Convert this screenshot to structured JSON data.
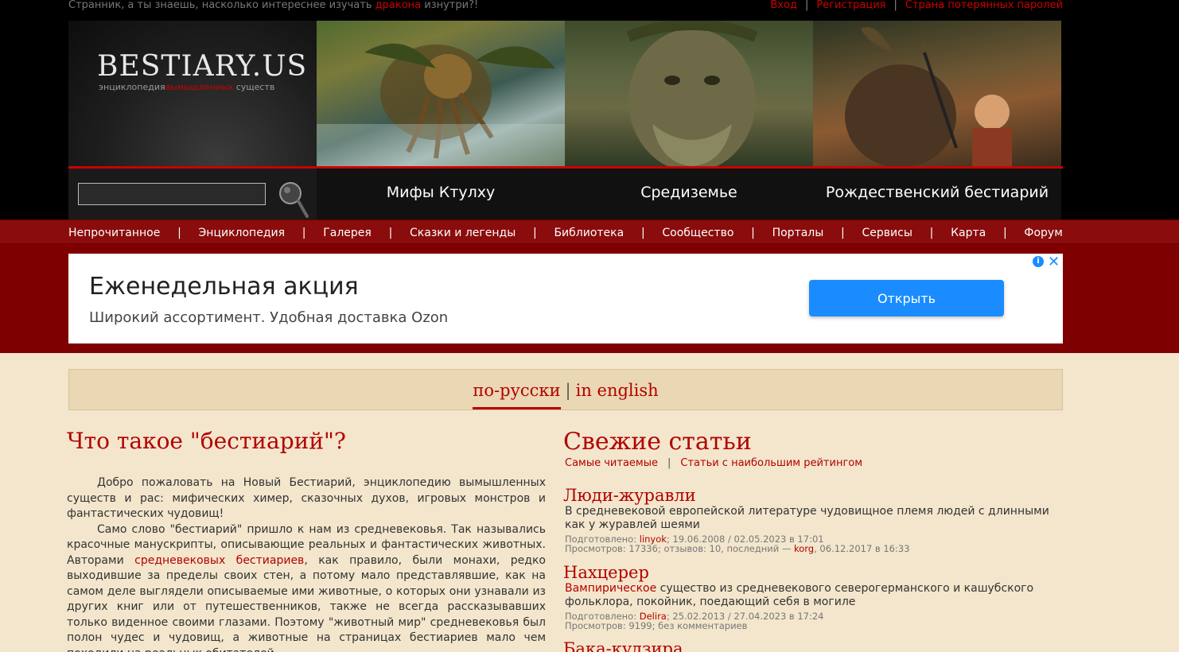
{
  "topbar": {
    "tagline_start": "Странник, а ты знаешь, насколько интереснее изучать ",
    "tagline_link": "дракона",
    "tagline_end": " изнутри?!",
    "login": "Вход",
    "register": "Регистрация",
    "lost_password": "Страна потерянных паролей",
    "separator": "|"
  },
  "logo": {
    "title": "BESTIARY.US",
    "sub_start": "энциклопедия",
    "sub_red": "вымышленных",
    "sub_end": " существ"
  },
  "search": {
    "value": ""
  },
  "panels": [
    {
      "caption": "Мифы Ктулху"
    },
    {
      "caption": "Средиземье"
    },
    {
      "caption": "Рождественский бестиарий"
    }
  ],
  "nav": {
    "items": [
      "Непрочитанное",
      "Энциклопедия",
      "Галерея",
      "Сказки и легенды",
      "Библиотека",
      "Сообщество",
      "Порталы",
      "Сервисы",
      "Карта",
      "Форум"
    ],
    "separator": "|"
  },
  "ad": {
    "title": "Еженедельная акция",
    "text": "Широкий ассортимент. Удобная доставка Ozon",
    "button": "Открыть",
    "info": "i",
    "close": "✕"
  },
  "lang": {
    "ru": "по-русски",
    "sep": "|",
    "en": "in english"
  },
  "left": {
    "heading": "Что такое \"бестиарий\"?",
    "p1": "Добро пожаловать на Новый Бестиарий, энциклопедию вымышленных существ и рас: мифических химер, сказочных духов, игровых монстров и фантастических чудовищ!",
    "p2_start": "Само слово \"бестиарий\" пришло к нам из средневековья. Так назывались красочные манускрипты, описывающие реальных и фантастических животных. Авторами ",
    "p2_link": "средневековых бестиариев",
    "p2_end": ", как правило, были монахи, редко выходившие за пределы своих стен, а потому мало представлявшие, как на самом деле выглядели описываемые ими животные, о которых они узнавали из других книг или от путешественников, также не всегда рассказывавших только виденное своими глазами. Поэтому \"животный мир\" средневековья был полон чудес и чудовищ, а животные на страницах бестиариев мало чем походили на реальных обитателей"
  },
  "right": {
    "heading": "Свежие статьи",
    "link_popular": "Самые читаемые",
    "link_rated": "Статьи с наибольшим рейтингом",
    "separator": "|",
    "articles": [
      {
        "title": "Люди-журавли",
        "desc_link": "",
        "desc": "В средневековой европейской литературе чудовищное племя людей с длинными как у журавлей шеями",
        "prepared_label": "Подготовлено: ",
        "author": "linyok",
        "dates": "; 19.06.2008 / 02.05.2023 в 17:01",
        "stats": "Просмотров: 17336; отзывов: 10, последний — ",
        "last_user": "korg",
        "last_date": ", 06.12.2017 в 16:33"
      },
      {
        "title": "Нахцерер",
        "desc_link": "Вампирическое",
        "desc": " существо из средневекового северогерманского и кашубского фольклора, покойник, поедающий себя в могиле",
        "prepared_label": "Подготовлено: ",
        "author": "Delira",
        "dates": "; 25.02.2013 / 27.04.2023 в 17:24",
        "stats": "Просмотров: 9199; без комментариев",
        "last_user": "",
        "last_date": ""
      },
      {
        "title": "Бака-кудзира"
      }
    ]
  }
}
